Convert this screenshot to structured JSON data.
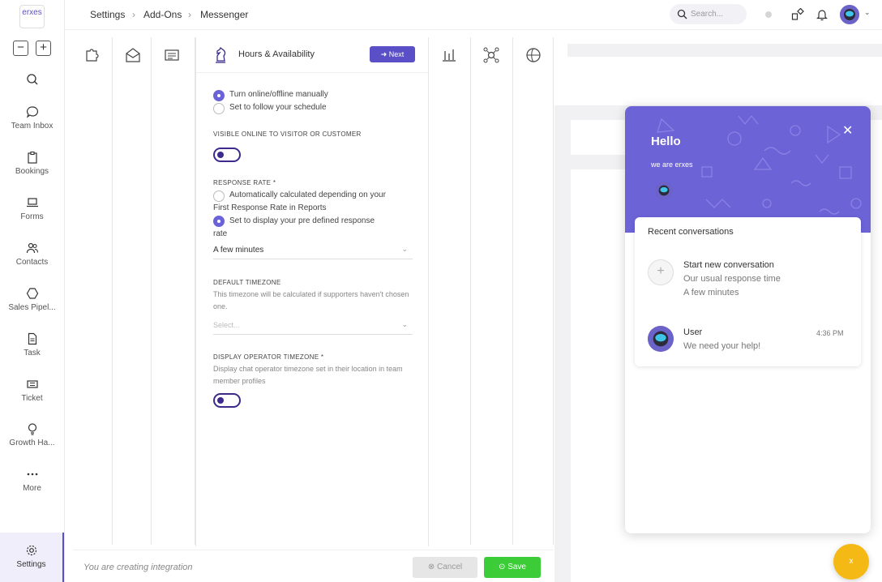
{
  "app": {
    "logo_text": "erxes"
  },
  "sidebar": {
    "zoom_out": "−",
    "zoom_in": "+",
    "items": [
      {
        "label": "",
        "icon": "search-icon"
      },
      {
        "label": "Team Inbox",
        "icon": "chat-icon"
      },
      {
        "label": "Bookings",
        "icon": "clipboard-icon"
      },
      {
        "label": "Forms",
        "icon": "laptop-icon"
      },
      {
        "label": "Contacts",
        "icon": "users-icon"
      },
      {
        "label": "Sales Pipel...",
        "icon": "pipeline-icon"
      },
      {
        "label": "Task",
        "icon": "file-icon"
      },
      {
        "label": "Ticket",
        "icon": "ticket-icon"
      },
      {
        "label": "Growth Ha...",
        "icon": "bulb-icon"
      },
      {
        "label": "More",
        "icon": "more-icon"
      }
    ],
    "settings_label": "Settings"
  },
  "header": {
    "breadcrumb": [
      "Settings",
      "Add-Ons",
      "Messenger"
    ],
    "search_placeholder": "Search..."
  },
  "form": {
    "step_title": "Hours & Availability",
    "next_label": "Next",
    "availability_options": [
      {
        "label": "Turn online/offline manually",
        "selected": true
      },
      {
        "label": "Set to follow your schedule",
        "selected": false
      }
    ],
    "visible_online_label": "VISIBLE ONLINE TO VISITOR OR CUSTOMER",
    "response_rate_label": "RESPONSE RATE *",
    "response_options": [
      {
        "line1": "Automatically calculated depending on your",
        "line2": "First Response Rate in Reports",
        "selected": false
      },
      {
        "line1": "Set to display your pre defined response",
        "line2": "rate",
        "selected": true
      }
    ],
    "response_value": "A few minutes",
    "timezone_label": "DEFAULT TIMEZONE",
    "timezone_help": "This timezone will be calculated if supporters haven't chosen one.",
    "timezone_placeholder": "Select...",
    "operator_tz_label": "DISPLAY OPERATOR TIMEZONE *",
    "operator_tz_help": "Display chat operator timezone set in their location in team member profiles"
  },
  "bottom": {
    "status_text": "You are creating integration",
    "cancel_label": "Cancel",
    "save_label": "Save"
  },
  "preview": {
    "hello": "Hello",
    "subtitle": "we are erxes",
    "recent_title": "Recent conversations",
    "new_conversation": {
      "title": "Start new conversation",
      "line1": "Our usual response time",
      "line2": "A few minutes"
    },
    "user_conversation": {
      "name": "User",
      "message": "We need your help!",
      "time": "4:36 PM"
    },
    "fab_label": "x"
  },
  "colors": {
    "accent": "#5b4fc7",
    "widget_header": "#6c63d7",
    "save_green": "#3ccc38",
    "fab_yellow": "#f5b915"
  }
}
